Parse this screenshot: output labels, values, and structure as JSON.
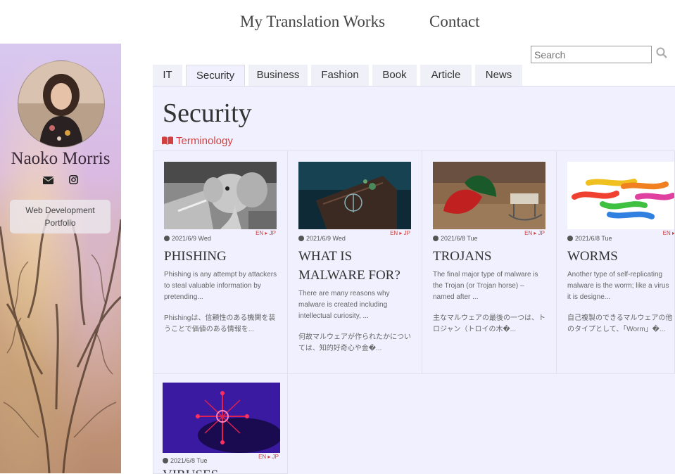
{
  "topnav": {
    "translation_works": "My Translation Works",
    "contact": "Contact"
  },
  "sidebar": {
    "name": "Naoko Morris",
    "social": {
      "mail_icon": "envelope-icon",
      "instagram_icon": "instagram-icon"
    },
    "portfolio_button": "Web Development Portfolio"
  },
  "search": {
    "placeholder": "Search",
    "value": ""
  },
  "tabs": [
    {
      "label": "IT"
    },
    {
      "label": "Security"
    },
    {
      "label": "Business"
    },
    {
      "label": "Fashion"
    },
    {
      "label": "Book"
    },
    {
      "label": "Article"
    },
    {
      "label": "News"
    }
  ],
  "active_tab": "Security",
  "page": {
    "title": "Security",
    "terminology": "Terminology"
  },
  "cards": [
    {
      "date": "2021/6/9 Wed",
      "lang": "EN ▸ JP",
      "title": "PHISHING",
      "excerpt_en": "Phishing is any attempt by attackers to steal valuable information by pretending...",
      "excerpt_jp": "Phishingは、信頼性のある機関を装うことで価値のある情報を..."
    },
    {
      "date": "2021/6/9 Wed",
      "lang": "EN ▸ JP",
      "title": "WHAT IS MALWARE FOR?",
      "excerpt_en": "There are many reasons why malware is created including intellectual curiosity, ...",
      "excerpt_jp": "何故マルウェアが作られたかについては、知的好奇心や金�..."
    },
    {
      "date": "2021/6/8 Tue",
      "lang": "EN ▸ JP",
      "title": "TROJANS",
      "excerpt_en": "The final major type of malware is the Trojan (or Trojan horse) – named after ...",
      "excerpt_jp": "主なマルウェアの最後の一つは、トロジャン（トロイの木�..."
    },
    {
      "date": "2021/6/8 Tue",
      "lang": "EN ▸",
      "title": "WORMS",
      "excerpt_en": "Another type of self-replicating malware is the worm; like a virus it is designe...",
      "excerpt_jp": "自己複製のできるマルウェアの他のタイプとして、「Worm」�..."
    },
    {
      "date": "2021/6/8 Tue",
      "lang": "EN ▸ JP",
      "title": "VIRUSES",
      "excerpt_en": "",
      "excerpt_jp": ""
    }
  ]
}
